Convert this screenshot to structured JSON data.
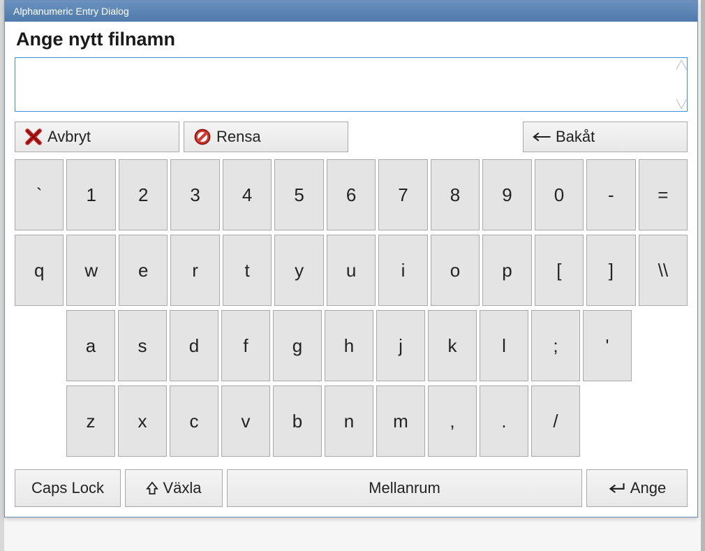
{
  "window": {
    "title": "Alphanumeric Entry Dialog"
  },
  "prompt": "Ange nytt filnamn",
  "input": {
    "value": "",
    "placeholder": ""
  },
  "actions": {
    "cancel": "Avbryt",
    "clear": "Rensa",
    "back": "Bakåt"
  },
  "keyboard": {
    "row1": [
      "`",
      "1",
      "2",
      "3",
      "4",
      "5",
      "6",
      "7",
      "8",
      "9",
      "0",
      "-",
      "="
    ],
    "row2": [
      "q",
      "w",
      "e",
      "r",
      "t",
      "y",
      "u",
      "i",
      "o",
      "p",
      "[",
      "]",
      "\\\\"
    ],
    "row3": [
      "a",
      "s",
      "d",
      "f",
      "g",
      "h",
      "j",
      "k",
      "l",
      ";",
      "'"
    ],
    "row4": [
      "z",
      "x",
      "c",
      "v",
      "b",
      "n",
      "m",
      ",",
      ".",
      "/"
    ]
  },
  "bottom": {
    "caps": "Caps Lock",
    "shift": "Växla",
    "space": "Mellanrum",
    "enter": "Ange"
  }
}
